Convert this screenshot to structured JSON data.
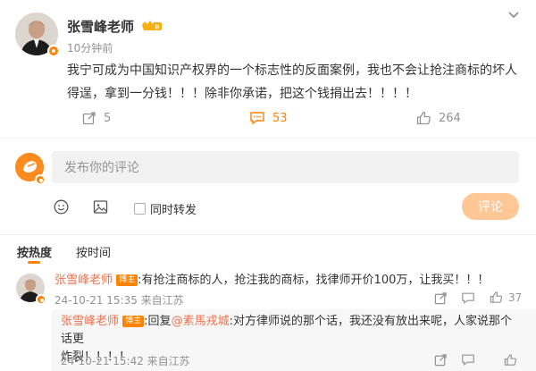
{
  "post": {
    "author": "张雪峰老师",
    "time": "10分钟前",
    "text_line1": "我宁可成为中国知识产权界的一个标志性的反面案例，我也不会让抢注商标的坏人",
    "text_line2": "得逞，拿到一分钱！！！除非你承诺，把这个钱捐出去！！！！",
    "repost_count": "5",
    "comment_count": "53",
    "like_count": "264"
  },
  "composer": {
    "placeholder": "发布你的评论",
    "repost_label": "同时转发",
    "submit_label": "评论"
  },
  "tabs": [
    {
      "label": "按热度"
    },
    {
      "label": "按时间"
    }
  ],
  "comments": [
    {
      "author": "张雪峰老师",
      "badge": "博主",
      "text": ":有抢注商标的人，抢注我的商标，找律师开价100万，让我买！！！",
      "meta": "24-10-21 15:35 来自江苏",
      "like_count": "37",
      "reply": {
        "author": "张雪峰老师",
        "badge": "博主",
        "prefix": ":回复",
        "mention": "@素馬戎城",
        "text_line1": ":对方律师说的那个话，我还没有放出来呢，人家说那个话更",
        "text_line2": "炸裂！！！！",
        "meta": "24-10-21 15:42 来自江苏"
      }
    }
  ],
  "colors": {
    "accent": "#ff8200",
    "name_link": "#eb7350",
    "muted": "#939393",
    "submit_disabled": "#ffc795"
  }
}
